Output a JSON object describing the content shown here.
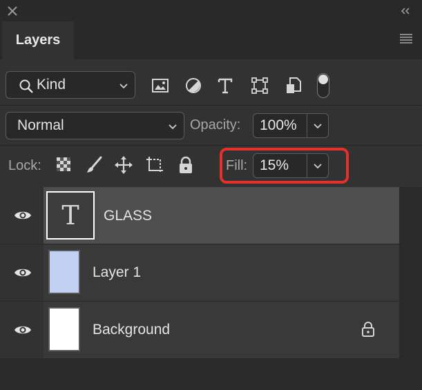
{
  "panel": {
    "tab_label": "Layers"
  },
  "filter": {
    "kind_label": "Kind"
  },
  "blend": {
    "mode": "Normal",
    "opacity_label": "Opacity:",
    "opacity_value": "100%"
  },
  "lock": {
    "label": "Lock:",
    "fill_label": "Fill:",
    "fill_value": "15%"
  },
  "layers": [
    {
      "name": "GLASS",
      "thumb_glyph": "T",
      "selected": true
    },
    {
      "name": "Layer 1",
      "selected": false
    },
    {
      "name": "Background",
      "locked": true,
      "selected": false
    }
  ],
  "colors": {
    "highlight_outline": "#e8302a",
    "layer1_thumb": "#c0cff2",
    "background_thumb": "#ffffff"
  }
}
